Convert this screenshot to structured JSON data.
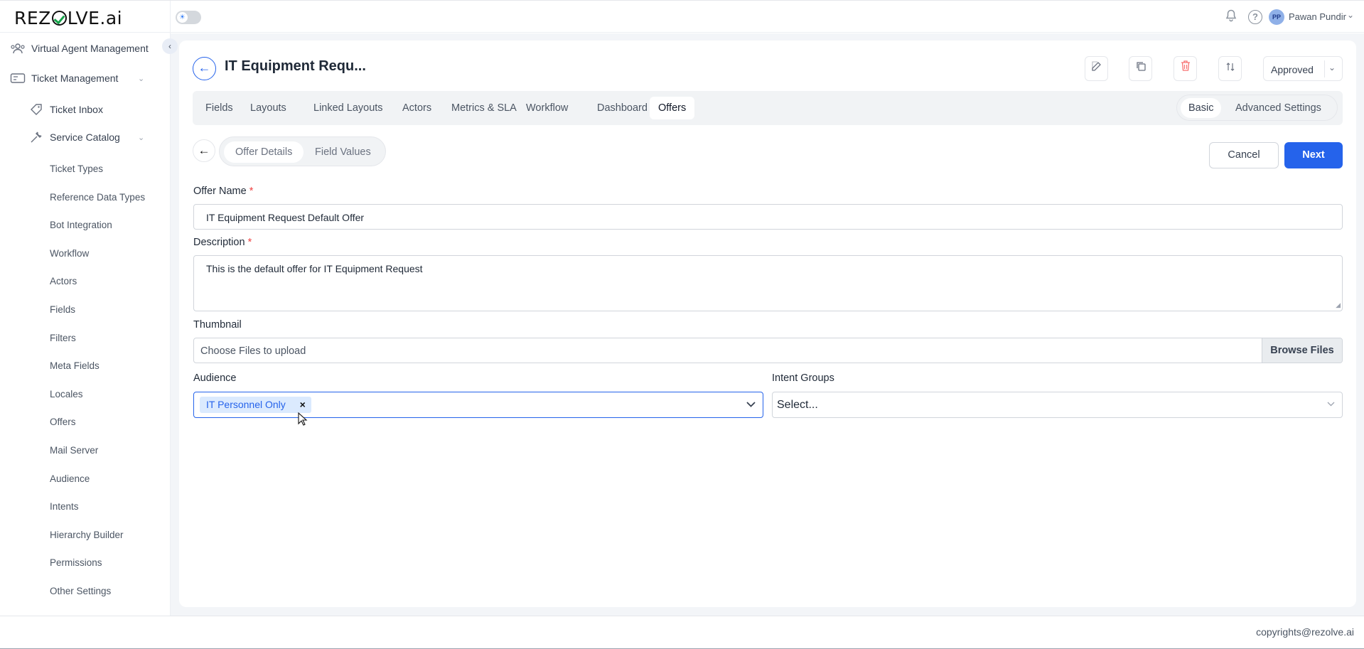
{
  "app": {
    "logo": "REZOLVE.ai",
    "logo_pre": "REZ",
    "logo_post": "LVE.ai"
  },
  "topbar": {
    "theme_toggle_icon": "sun-icon",
    "user_initials": "PP",
    "user_name": "Pawan Pundir"
  },
  "sidebar": {
    "top_items": [
      {
        "label": "Virtual Agent Management",
        "icon": "users-icon"
      },
      {
        "label": "Ticket Management",
        "icon": "ticket-icon",
        "expanded": true
      }
    ],
    "ticket_children": [
      {
        "label": "Ticket Inbox",
        "icon": "tag-icon"
      },
      {
        "label": "Service Catalog",
        "icon": "wrench-icon",
        "expanded": true
      }
    ],
    "catalog_items": [
      "Ticket Types",
      "Reference Data Types",
      "Bot Integration",
      "Workflow",
      "Actors",
      "Fields",
      "Filters",
      "Meta Fields",
      "Locales",
      "Offers",
      "Mail Server",
      "Audience",
      "Intents",
      "Hierarchy Builder",
      "Permissions",
      "Other Settings"
    ]
  },
  "header": {
    "title": "IT Equipment Requ...",
    "status": "Approved",
    "tools": [
      "edit-icon",
      "copy-icon",
      "delete-icon",
      "sort-icon"
    ]
  },
  "tabs": [
    "Fields",
    "Layouts",
    "Linked Layouts",
    "Actors",
    "Metrics & SLA",
    "Workflow",
    "Dashboard",
    "Offers"
  ],
  "active_tab": "Offers",
  "modes": [
    "Basic",
    "Advanced Settings"
  ],
  "active_mode": "Basic",
  "subtabs": [
    "Offer Details",
    "Field Values"
  ],
  "active_subtab": "Offer Details",
  "actions": {
    "cancel": "Cancel",
    "next": "Next"
  },
  "form": {
    "offer_name_label": "Offer Name",
    "offer_name_value": "IT Equipment Request Default Offer",
    "description_label": "Description",
    "description_value": "This is the default offer for IT Equipment Request",
    "required_mark": "*",
    "thumbnail_label": "Thumbnail",
    "thumbnail_placeholder": "Choose Files to upload",
    "browse_label": "Browse Files",
    "audience_label": "Audience",
    "audience_selected": [
      "IT Personnel Only"
    ],
    "chip_remove": "×",
    "intent_groups_label": "Intent Groups",
    "intent_groups_placeholder": "Select..."
  },
  "colors": {
    "accent": "#2563eb",
    "required": "#ef4444",
    "chip_bg": "#dbeafe",
    "page_bg": "#f3f5f8"
  },
  "footer": {
    "copyright": "copyrights@rezolve.ai"
  }
}
